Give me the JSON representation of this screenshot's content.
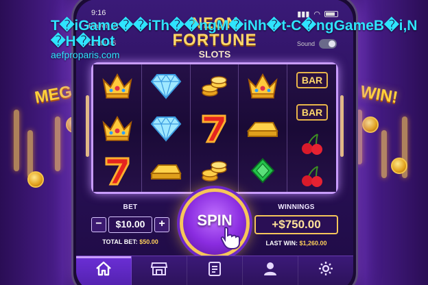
{
  "overlay": {
    "title": "T�iGame��iTh��ngM�iNh�t-C�ngGameB�i,N�H�Hot",
    "site": "aefproparis.com"
  },
  "status_bar": {
    "time": "9:16"
  },
  "player": {
    "name": "Player_01",
    "level": "LEVEL 45"
  },
  "logo": {
    "line1": "NEON",
    "line2": "FORTUNE",
    "line3": "SLOTS"
  },
  "sound": {
    "label": "Sound",
    "enabled": false
  },
  "backdrop": {
    "left_banner": "MEGA WIN!",
    "right_banner": "MEGA WIN!"
  },
  "reels": [
    [
      "crown",
      "crown",
      "seven"
    ],
    [
      "diamond",
      "diamond",
      "gold-bar"
    ],
    [
      "coins",
      "seven",
      "coins"
    ],
    [
      "crown",
      "gold-bar",
      "emerald"
    ],
    [
      "bar",
      "bar",
      "cherries",
      "cherries"
    ]
  ],
  "bar_symbol_text": "BAR",
  "controls": {
    "bet_label": "BET",
    "bet_value": "$10.00",
    "minus": "−",
    "plus": "+",
    "total_bet_label": "TOTAL BET:",
    "total_bet_value": "$50.00",
    "spin_label": "SPIN",
    "winnings_label": "WINNINGS",
    "winnings_value": "+$750.00",
    "last_win_label": "LAST WIN:",
    "last_win_value": "$1,260.00"
  },
  "nav": [
    {
      "icon": "home-icon",
      "active": true
    },
    {
      "icon": "shop-icon",
      "active": false
    },
    {
      "icon": "clipboard-icon",
      "active": false
    },
    {
      "icon": "profile-icon",
      "active": false
    },
    {
      "icon": "settings-icon",
      "active": false
    }
  ],
  "colors": {
    "accent": "#8a2ce0",
    "gold": "#f6c65a",
    "title": "#2fe4ff"
  }
}
